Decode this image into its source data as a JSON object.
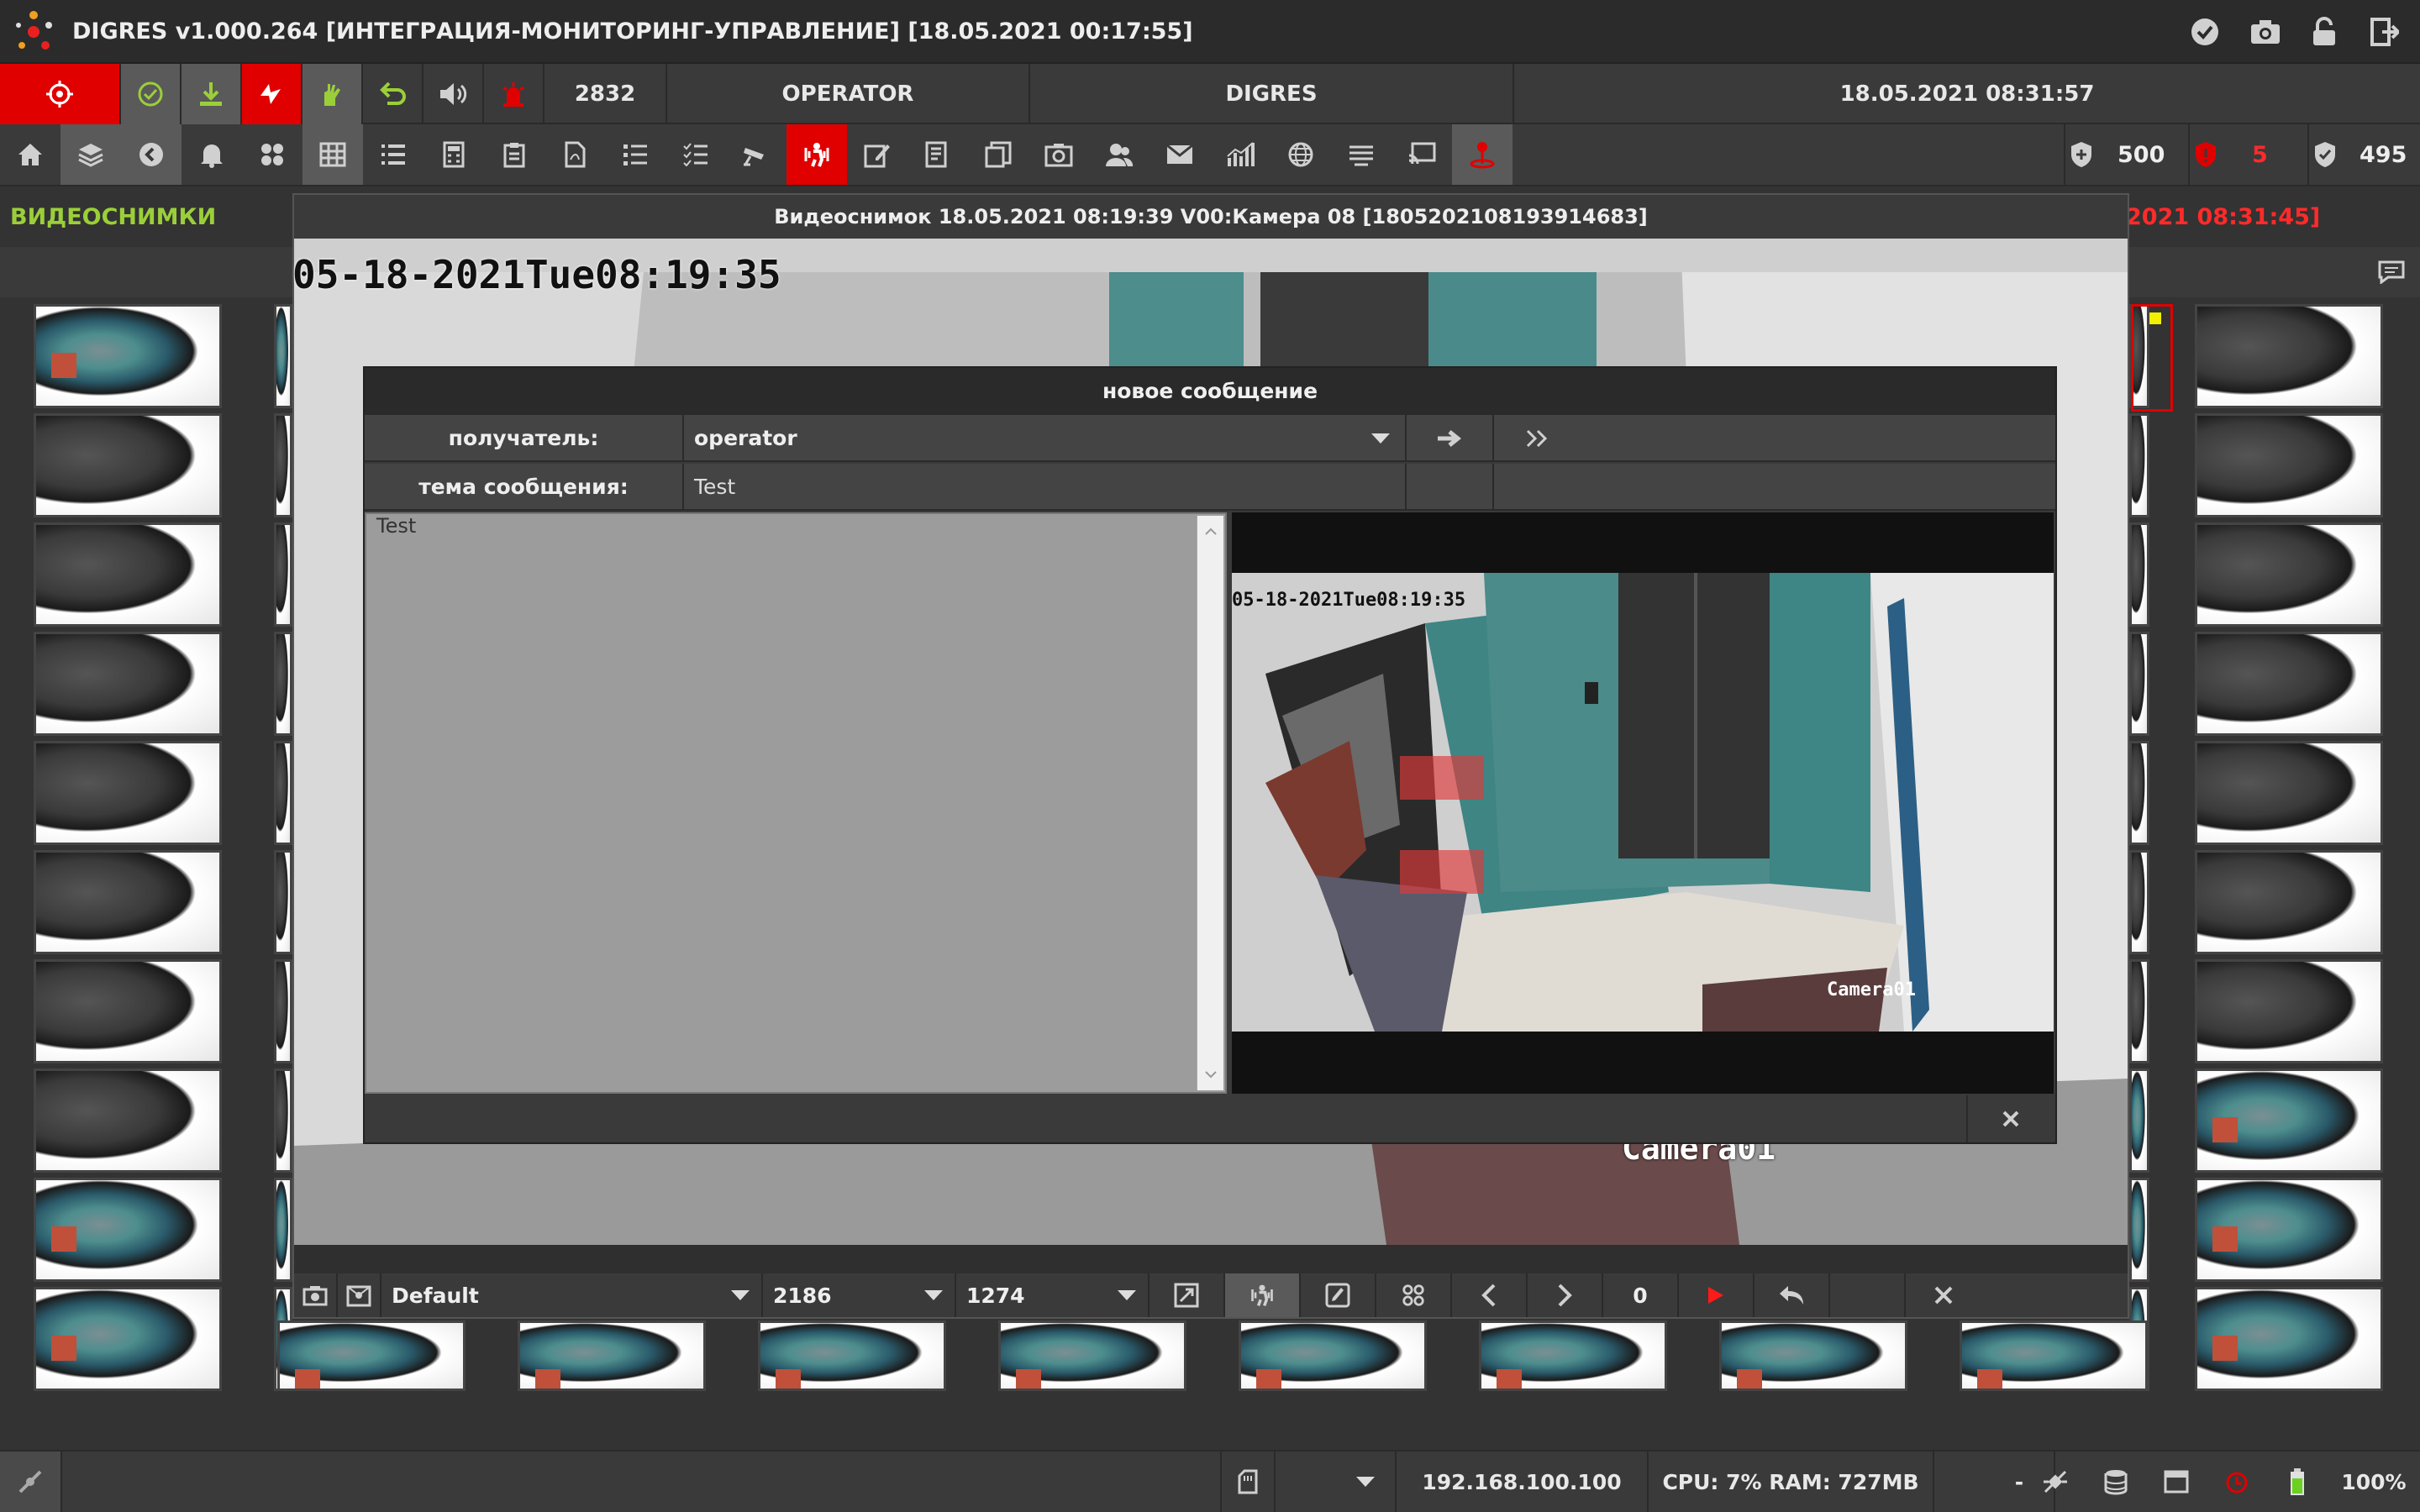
{
  "titlebar": {
    "title": "DIGRES v1.000.264 [ИНТЕГРАЦИЯ-МОНИТОРИНГ-УПРАВЛЕНИЕ] [18.05.2021 00:17:55]",
    "icons": [
      "check-circle-icon",
      "camera-icon",
      "lock-icon",
      "exit-icon"
    ]
  },
  "row2": {
    "counter": "2832",
    "user": "OPERATOR",
    "system": "DIGRES",
    "datetime": "18.05.2021 08:31:57"
  },
  "toolbar": {
    "counts": {
      "total": "500",
      "alarm": "5",
      "ok": "495"
    },
    "colors": {
      "accent_red": "#e00000",
      "green": "#9bcf39"
    }
  },
  "section": {
    "title": "ВИДЕОСНИМКИ",
    "right_text": "2021 08:31:45]"
  },
  "viewer": {
    "title": "Видеоснимок 18.05.2021 08:19:39 V00:Камера 08 [1805202108193914683]",
    "stamp": "05-18-2021Tue08:19:35",
    "camera_label": "Camera01",
    "profile": "Default",
    "width": "2186",
    "height": "1274",
    "frame": "0"
  },
  "message": {
    "header": "новое сообщение",
    "recipient_label": "получатель:",
    "recipient_value": "operator",
    "subject_label": "тема сообщения:",
    "subject_value": "Test",
    "body": "Test",
    "image_stamp": "05-18-2021Tue08:19:35",
    "image_camera": "Camera01"
  },
  "status": {
    "ip": "192.168.100.100",
    "cpu_ram": "CPU: 7% RAM: 727MB",
    "dash": "-",
    "zoom": "100%"
  }
}
